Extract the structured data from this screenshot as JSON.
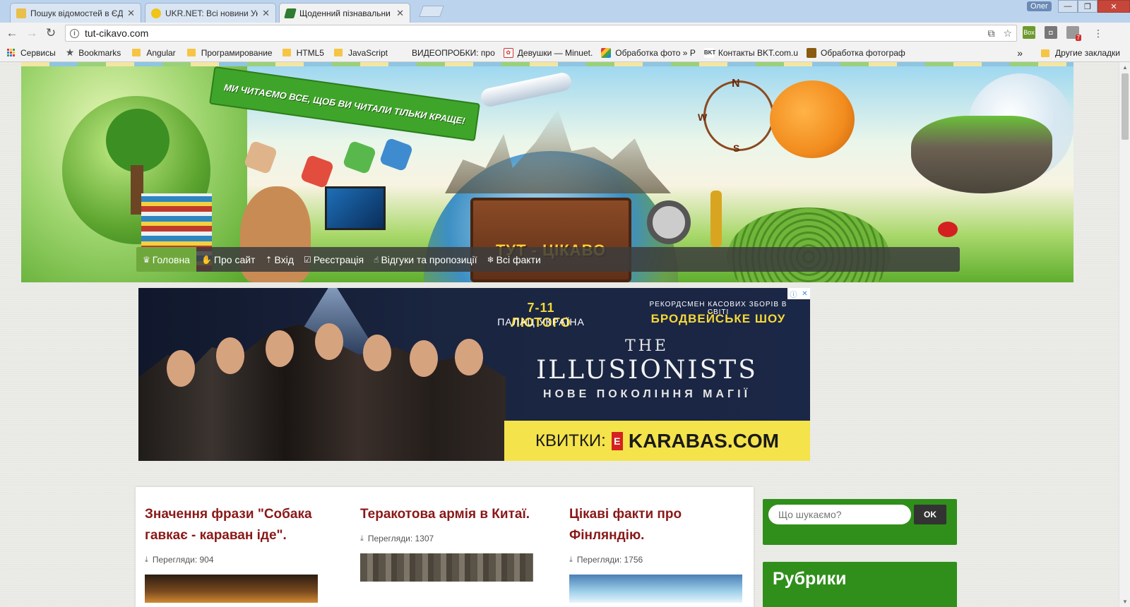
{
  "browser": {
    "tabs": [
      {
        "title": "Пошук відомостей в ЄД",
        "active": false,
        "favicon_color": "#e8c04a"
      },
      {
        "title": "UKR.NET: Всі новини Укр",
        "active": false,
        "favicon_color": "#f0c419"
      },
      {
        "title": "Щоденний пізнавальни",
        "active": true,
        "favicon_color": "#2e7d32"
      }
    ],
    "profile_name": "Олег",
    "url": "tut-cikavo.com",
    "extension_badge": "7"
  },
  "bookmarks": {
    "items": [
      {
        "label": "Сервисы",
        "icon": "apps-grid-icon"
      },
      {
        "label": "Bookmarks",
        "icon": "star-icon"
      },
      {
        "label": "Angular",
        "icon": "folder-icon"
      },
      {
        "label": "Програмирование",
        "icon": "folder-icon"
      },
      {
        "label": "HTML5",
        "icon": "folder-icon"
      },
      {
        "label": "JavaScript",
        "icon": "folder-icon"
      },
      {
        "label": "ВИДЕОПРОБКИ: про",
        "icon": "page-icon"
      },
      {
        "label": "Девушки — Minuet.",
        "icon": "page-icon"
      },
      {
        "label": "Обработка фото » P",
        "icon": "page-icon"
      },
      {
        "label": "Контакты BKT.com.u",
        "icon": "page-icon"
      },
      {
        "label": "Обработка фотограф",
        "icon": "page-icon"
      }
    ],
    "overflow": "»",
    "other": "Другие закладки"
  },
  "header": {
    "slogan": "МИ ЧИТАЄМО ВСЕ, ЩОБ ВИ ЧИТАЛИ ТІЛЬКИ КРАЩЕ!",
    "site_name": "ТУТ - ЦІКАВО",
    "compass_letters": [
      "N",
      "W",
      "S"
    ]
  },
  "nav": {
    "items": [
      {
        "label": "Головна",
        "icon": "home-icon"
      },
      {
        "label": "Про сайт",
        "icon": "thumb-icon"
      },
      {
        "label": "Вхід",
        "icon": "login-icon"
      },
      {
        "label": "Реєстрація",
        "icon": "check-icon"
      },
      {
        "label": "Відгуки та пропозиції",
        "icon": "hand-icon"
      },
      {
        "label": "Всі факти",
        "icon": "snowflake-icon"
      }
    ]
  },
  "ad": {
    "date": "7-11 ЛЮТОГО",
    "venue": "ПАЛАЦ УКРАЇНА",
    "record": "РЕКОРДСМЕН КАСОВИХ ЗБОРІВ В СВІТІ",
    "show": "БРОДВЕЙСЬКЕ ШОУ",
    "the": "THE",
    "title": "ILLUSIONISTS",
    "subtitle": "НОВЕ ПОКОЛІННЯ МАГІЇ",
    "tickets": "КВИТКИ:",
    "ticket_logo": "E",
    "site": "KARABAS.COM"
  },
  "posts": [
    {
      "title": "Значення фрази \"Собака гавкає - караван іде\".",
      "views_label": "Перегляди: 904"
    },
    {
      "title": "Теракотова армія в Китаї.",
      "views_label": "Перегляди: 1307"
    },
    {
      "title": "Цікаві факти про Фінляндію.",
      "views_label": "Перегляди: 1756"
    }
  ],
  "sidebar": {
    "search_placeholder": "Що шукаємо?",
    "search_button": "OK",
    "rubrics_title": "Рубрики"
  }
}
